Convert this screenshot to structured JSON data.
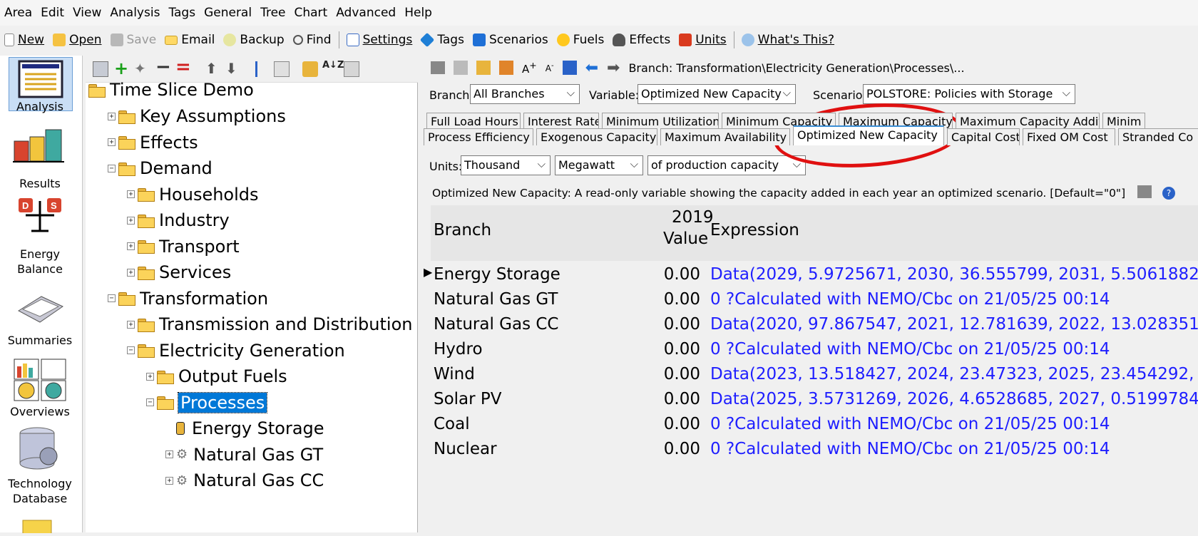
{
  "menu": [
    "Area",
    "Edit",
    "View",
    "Analysis",
    "Tags",
    "General",
    "Tree",
    "Chart",
    "Advanced",
    "Help"
  ],
  "toolbar": {
    "new": "New",
    "open": "Open",
    "save": "Save",
    "email": "Email",
    "backup": "Backup",
    "find": "Find",
    "settings": "Settings",
    "tags": "Tags",
    "scenarios": "Scenarios",
    "fuels": "Fuels",
    "effects": "Effects",
    "units": "Units",
    "whats_this": "What's This?"
  },
  "leftbar": [
    "Analysis",
    "Results",
    "Energy Balance",
    "Summaries",
    "Overviews",
    "Technology Database"
  ],
  "tree": {
    "root": "Time Slice Demo",
    "nodes": [
      {
        "label": "Key Assumptions"
      },
      {
        "label": "Effects"
      },
      {
        "label": "Demand"
      },
      {
        "label": "Households"
      },
      {
        "label": "Industry"
      },
      {
        "label": "Transport"
      },
      {
        "label": "Services"
      },
      {
        "label": "Transformation"
      },
      {
        "label": "Transmission and Distribution"
      },
      {
        "label": "Electricity Generation"
      },
      {
        "label": "Output Fuels"
      },
      {
        "label": "Processes"
      },
      {
        "label": "Energy Storage"
      },
      {
        "label": "Natural Gas GT"
      },
      {
        "label": "Natural Gas CC"
      }
    ]
  },
  "breadcrumb": "Branch: Transformation\\Electricity Generation\\Processes\\...",
  "filters": {
    "branch_label": "Branch:",
    "branch_value": "All Branches",
    "variable_label": "Variable:",
    "variable_value": "Optimized New Capacity",
    "scenario_label": "Scenario:",
    "scenario_value": "POLSTORE: Policies with Storage"
  },
  "tabs_row1": [
    "Full Load Hours",
    "Interest Rate",
    "Minimum Utilization",
    "Minimum Capacity",
    "Maximum Capacity",
    "Maximum Capacity Addition",
    "Minim"
  ],
  "tabs_row2": [
    "Process Efficiency",
    "Exogenous Capacity",
    "Maximum Availability",
    "Optimized New Capacity",
    "Capital Cost",
    "Fixed OM Cost",
    "Stranded Co"
  ],
  "units": {
    "label": "Units:",
    "scale": "Thousand",
    "unit": "Megawatt",
    "per": "of production capacity"
  },
  "description": "Optimized New Capacity: A read-only variable showing the capacity added in each year an optimized scenario. [Default=\"0\"]",
  "grid": {
    "col_branch": "Branch",
    "col_year": "2019",
    "col_value": "Value",
    "col_expr": "Expression",
    "rows": [
      {
        "branch": "Energy Storage",
        "value": "0.00",
        "expr": "Data(2029, 5.9725671, 2030, 36.555799, 2031, 5.5061882,"
      },
      {
        "branch": "Natural Gas GT",
        "value": "0.00",
        "expr": "0 ?Calculated with NEMO/Cbc on 21/05/25 00:14"
      },
      {
        "branch": "Natural Gas CC",
        "value": "0.00",
        "expr": "Data(2020, 97.867547, 2021, 12.781639, 2022, 13.028351,"
      },
      {
        "branch": "Hydro",
        "value": "0.00",
        "expr": "0 ?Calculated with NEMO/Cbc on 21/05/25 00:14"
      },
      {
        "branch": "Wind",
        "value": "0.00",
        "expr": "Data(2023, 13.518427, 2024, 23.47323, 2025, 23.454292, 2"
      },
      {
        "branch": "Solar PV",
        "value": "0.00",
        "expr": "Data(2025, 3.5731269, 2026, 4.6528685, 2027, 0.51997849"
      },
      {
        "branch": "Coal",
        "value": "0.00",
        "expr": "0 ?Calculated with NEMO/Cbc on 21/05/25 00:14"
      },
      {
        "branch": "Nuclear",
        "value": "0.00",
        "expr": "0 ?Calculated with NEMO/Cbc on 21/05/25 00:14"
      }
    ]
  },
  "colors": {
    "accent": "#0078d7",
    "expression": "#1e1eff",
    "annotation": "#e01010"
  }
}
